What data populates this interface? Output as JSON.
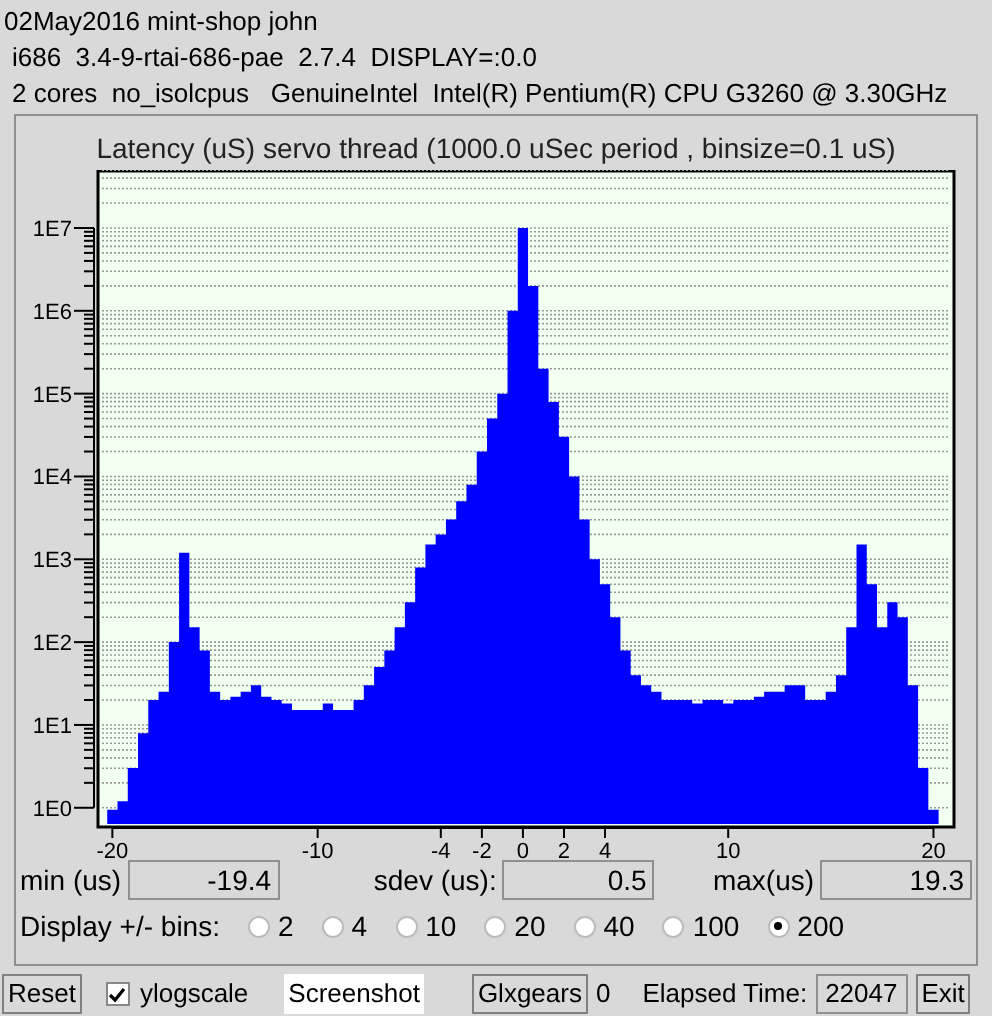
{
  "header_lines": [
    "02May2016 mint-shop john",
    "i686  3.4-9-rtai-686-pae  2.7.4  DISPLAY=:0.0",
    "2 cores  no_isolcpus   GenuineIntel  Intel(R) Pentium(R) CPU G3260 @ 3.30GHz"
  ],
  "histogram": {
    "title": "Latency (uS) servo thread (1000.0 uSec period , binsize=0.1 uS)",
    "y_labels": [
      "1E7",
      "1E6",
      "1E5",
      "1E4",
      "1E3",
      "1E2",
      "1E1",
      "1E0"
    ],
    "x_labels": [
      "-20",
      "-10",
      "-4",
      "-2",
      "0",
      "2",
      "4",
      "10",
      "20"
    ]
  },
  "stats": [
    {
      "label": "min (us)",
      "value": "-19.4"
    },
    {
      "label": "sdev (us):",
      "value": "0.5"
    },
    {
      "label": "max(us)",
      "value": "19.3"
    }
  ],
  "bins": {
    "label": "Display +/- bins:",
    "options": [
      {
        "label": "2",
        "selected": false
      },
      {
        "label": "4",
        "selected": false
      },
      {
        "label": "10",
        "selected": false
      },
      {
        "label": "20",
        "selected": false
      },
      {
        "label": "40",
        "selected": false
      },
      {
        "label": "100",
        "selected": false
      },
      {
        "label": "200",
        "selected": true
      }
    ]
  },
  "toolbar": {
    "reset": "Reset",
    "ylogscale": {
      "label": "ylogscale",
      "checked": true
    },
    "screenshot": "Screenshot",
    "glxgears": "Glxgears",
    "glxgears_count": "0",
    "elapsed_label": "Elapsed Time:",
    "elapsed_value": "22047",
    "exit": "Exit"
  }
}
